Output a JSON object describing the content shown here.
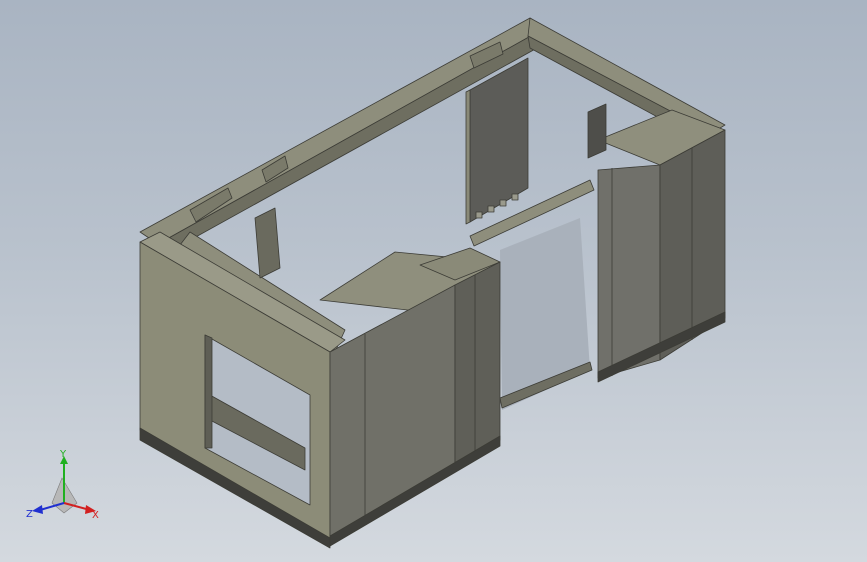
{
  "viewport": {
    "background_top": "#a9b4c2",
    "background_bottom": "#d4d9df"
  },
  "model": {
    "panel_color": "#8c8c78",
    "panel_dark": "#5a5a55",
    "panel_edge": "#3c3c36"
  },
  "triad": {
    "x_label": "X",
    "y_label": "Y",
    "z_label": "Z",
    "x_color": "#d22020",
    "y_color": "#20b020",
    "z_color": "#2030d0"
  }
}
